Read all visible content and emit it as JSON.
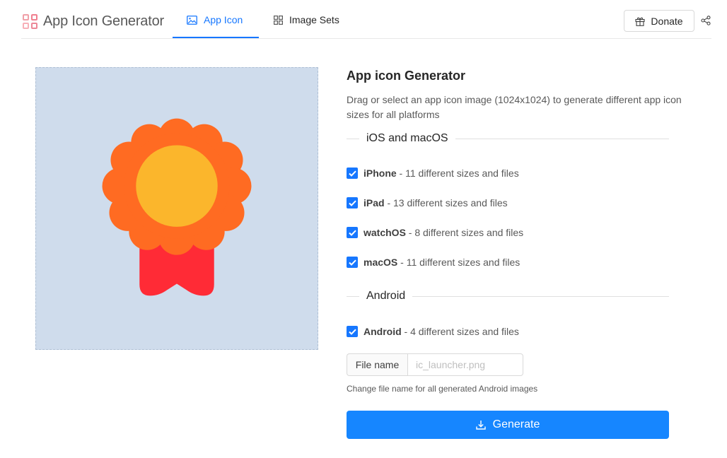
{
  "app": {
    "title": "App Icon Generator",
    "logo_colors": [
      "#f0a0a8",
      "#f08090",
      "#f7b0b8",
      "#ec8898"
    ]
  },
  "nav": {
    "tabs": [
      {
        "label": "App Icon",
        "icon": "image-icon",
        "active": true
      },
      {
        "label": "Image Sets",
        "icon": "grid-icon",
        "active": false
      }
    ],
    "donate_label": "Donate",
    "share_icon": "share-icon"
  },
  "preview": {
    "icon": "award-ribbon-icon",
    "background": "#cfdcec",
    "colors": {
      "petals": "#ff6b22",
      "center": "#fbb62c",
      "ribbon": "#ff2b36"
    }
  },
  "panel": {
    "title": "App icon Generator",
    "description": "Drag or select an app icon image (1024x1024) to generate different app icon sizes for all platforms",
    "sections": [
      {
        "heading": "iOS and macOS",
        "options": [
          {
            "name": "iPhone",
            "detail": " - 11 different sizes and files",
            "checked": true
          },
          {
            "name": "iPad",
            "detail": " - 13 different sizes and files",
            "checked": true
          },
          {
            "name": "watchOS",
            "detail": " - 8 different sizes and files",
            "checked": true
          },
          {
            "name": "macOS",
            "detail": " - 11 different sizes and files",
            "checked": true
          }
        ]
      },
      {
        "heading": "Android",
        "options": [
          {
            "name": "Android",
            "detail": " - 4 different sizes and files",
            "checked": true
          }
        ]
      }
    ],
    "filename": {
      "label": "File name",
      "value": "",
      "placeholder": "ic_launcher.png",
      "hint": "Change file name for all generated Android images"
    },
    "generate_label": "Generate"
  },
  "colors": {
    "accent": "#1677ff",
    "button": "#1686ff"
  }
}
